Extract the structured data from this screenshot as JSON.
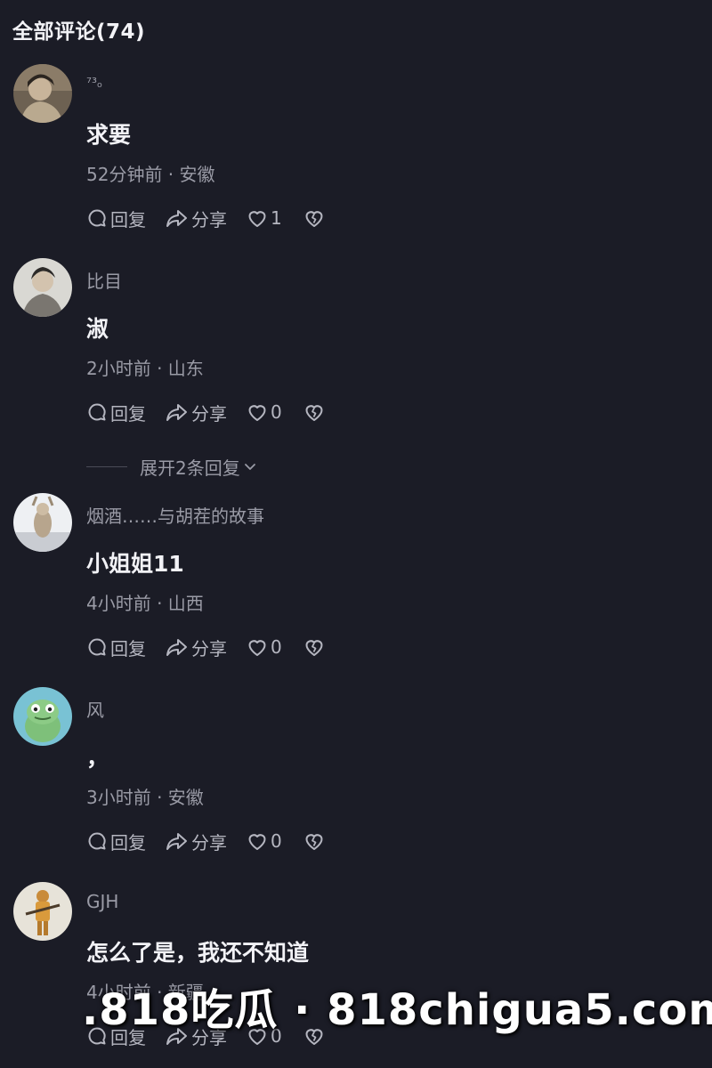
{
  "header": {
    "title": "全部评论(74)"
  },
  "actions_labels": {
    "reply": "回复",
    "share": "分享"
  },
  "comments": [
    {
      "username": "⁷³ₒ",
      "content": "求要",
      "meta": "52分钟前 · 安徽",
      "likes": "1"
    },
    {
      "username": "比目",
      "content": "淑",
      "meta": "2小时前 · 山东",
      "likes": "0",
      "expand": "展开2条回复"
    },
    {
      "username": "烟酒……与胡茬的故事",
      "content": "小姐姐11",
      "meta": "4小时前 · 山西",
      "likes": "0"
    },
    {
      "username": "风",
      "content": "，",
      "meta": "3小时前 · 安徽",
      "likes": "0"
    },
    {
      "username": "GJH",
      "content": "怎么了是，我还不知道",
      "meta": "4小时前 · 新疆",
      "likes": "0"
    }
  ],
  "watermark": {
    "text": ".818吃瓜 · 818chigua5.com"
  },
  "colors": {
    "background": "#1b1c26",
    "primary_text": "#f2f2f6",
    "secondary_text": "#9a9ba6",
    "watermark_dot": "#e0303a"
  }
}
